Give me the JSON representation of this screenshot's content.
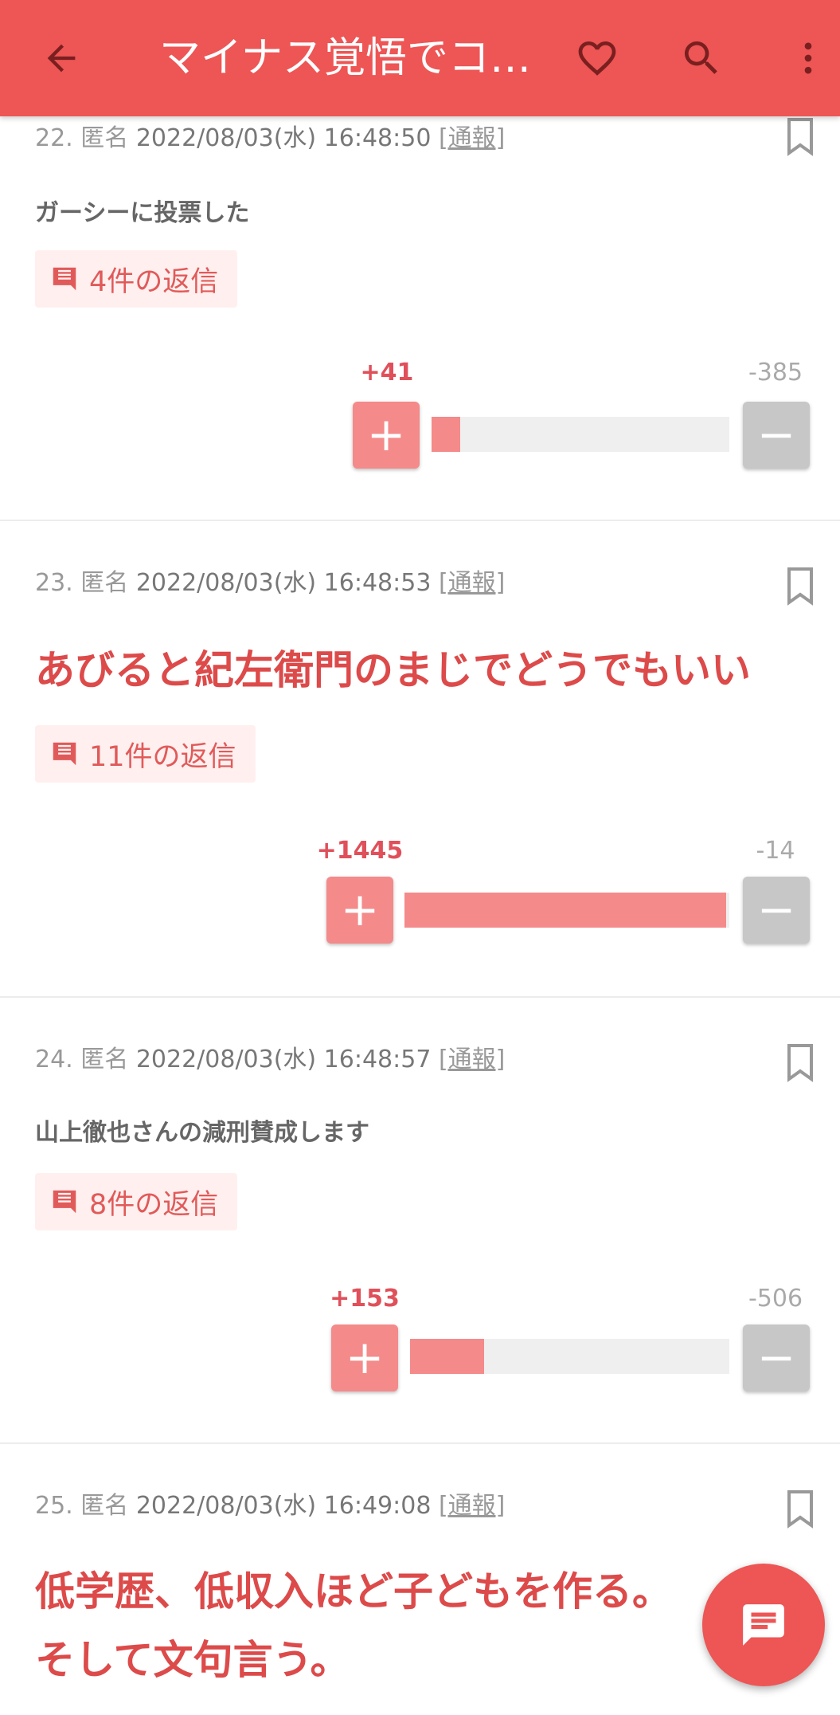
{
  "header": {
    "title": "マイナス覚悟でコ…",
    "back_icon": "arrow-back-icon",
    "favorite_icon": "heart-outline-icon",
    "search_icon": "search-icon",
    "more_icon": "more-vert-icon",
    "color": "#ee5555"
  },
  "comments": [
    {
      "number": "22.",
      "author": "匿名",
      "date": "2022/08/03(水) 16:48:50",
      "report": "[通報]",
      "text": "ガーシーに投票した",
      "replies": "4件の返信",
      "plus": "+41",
      "minus": "-385",
      "plus_ratio": 0.096
    },
    {
      "number": "23.",
      "author": "匿名",
      "date": "2022/08/03(水) 16:48:53",
      "report": "[通報]",
      "text": "あびると紀左衛門のまじでどうでもいい",
      "replies": "11件の返信",
      "plus": "+1445",
      "minus": "-14",
      "plus_ratio": 0.99
    },
    {
      "number": "24.",
      "author": "匿名",
      "date": "2022/08/03(水) 16:48:57",
      "report": "[通報]",
      "text": "山上徹也さんの減刑賛成します",
      "replies": "8件の返信",
      "plus": "+153",
      "minus": "-506",
      "plus_ratio": 0.232
    },
    {
      "number": "25.",
      "author": "匿名",
      "date": "2022/08/03(水) 16:49:08",
      "report": "[通報]",
      "text_line1": "低学歴、低収入ほど子どもを作る。",
      "text_line2": "そして文句言う。"
    }
  ],
  "fab": {
    "icon": "comment-icon"
  }
}
